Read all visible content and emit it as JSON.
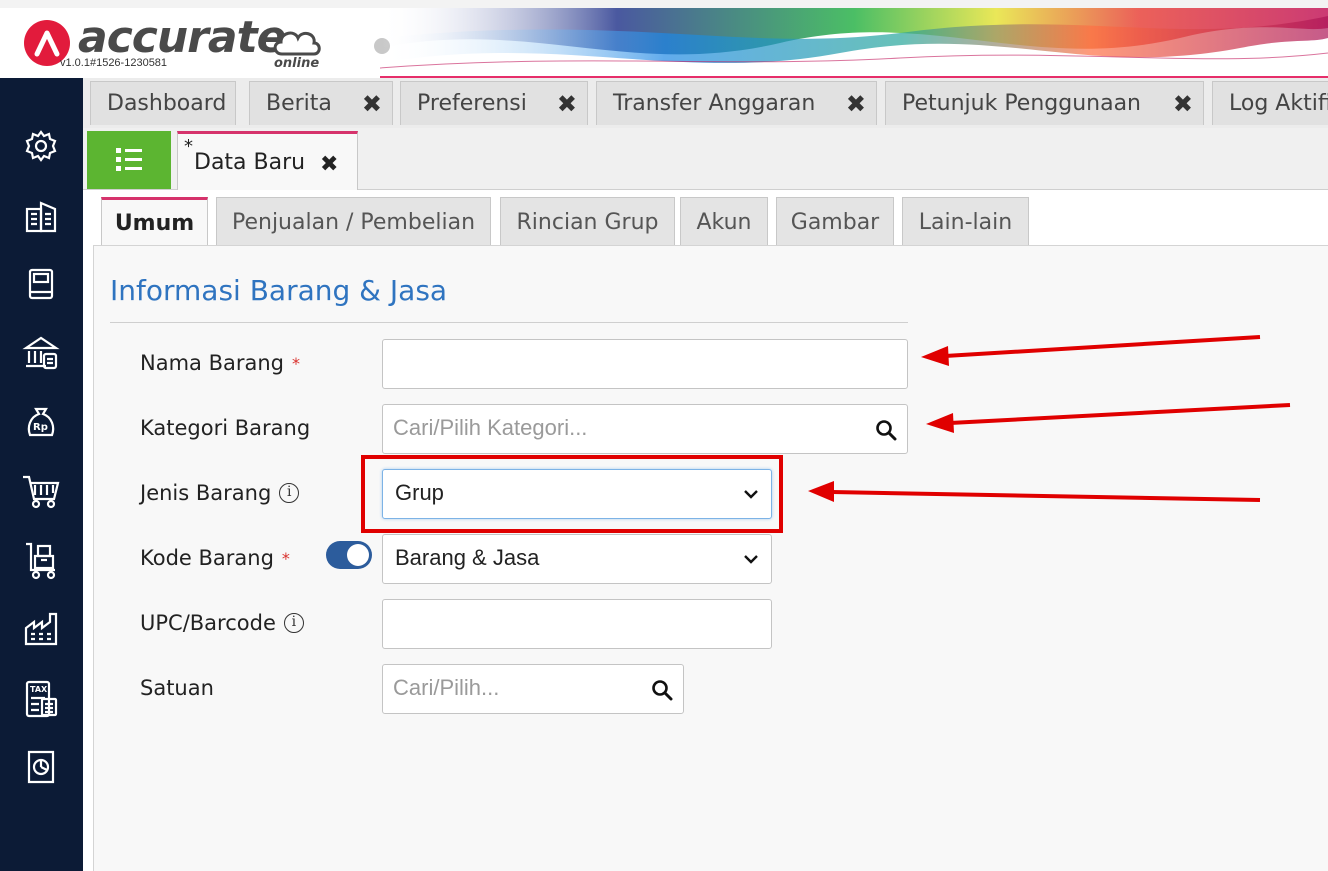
{
  "header": {
    "brand": "accurate",
    "brand_sub": "online",
    "version": "v1.0.1#1526-1230581"
  },
  "sidebar": {
    "items": [
      {
        "icon": "gear-icon"
      },
      {
        "icon": "building-icon"
      },
      {
        "icon": "book-icon"
      },
      {
        "icon": "bank-icon"
      },
      {
        "icon": "money-bag-icon"
      },
      {
        "icon": "cart-icon"
      },
      {
        "icon": "box-cart-icon"
      },
      {
        "icon": "factory-icon"
      },
      {
        "icon": "tax-icon"
      },
      {
        "icon": "report-chart-icon"
      }
    ],
    "bag_label": "Rp",
    "tax_label": "TAX"
  },
  "top_tabs": [
    {
      "label": "Dashboard",
      "closable": false
    },
    {
      "label": "Berita",
      "closable": true
    },
    {
      "label": "Preferensi",
      "closable": true
    },
    {
      "label": "Transfer Anggaran",
      "closable": true
    },
    {
      "label": "Petunjuk Penggunaan",
      "closable": true
    },
    {
      "label": "Log Aktifi",
      "closable": false
    }
  ],
  "close_glyph": "✖",
  "doc_tab": {
    "modified_mark": "*",
    "label": "Data Baru"
  },
  "inner_tabs": [
    {
      "label": "Umum",
      "active": true
    },
    {
      "label": "Penjualan / Pembelian",
      "active": false
    },
    {
      "label": "Rincian Grup",
      "active": false
    },
    {
      "label": "Akun",
      "active": false
    },
    {
      "label": "Gambar",
      "active": false
    },
    {
      "label": "Lain-lain",
      "active": false
    }
  ],
  "section": {
    "title": "Informasi Barang & Jasa"
  },
  "form": {
    "nama_barang": {
      "label": "Nama Barang",
      "required_mark": "*",
      "value": ""
    },
    "kategori_barang": {
      "label": "Kategori Barang",
      "placeholder": "Cari/Pilih Kategori..."
    },
    "jenis_barang": {
      "label": "Jenis Barang",
      "info_mark": "i",
      "selected": "Grup"
    },
    "kode_barang": {
      "label": "Kode Barang",
      "required_mark": "*",
      "toggle_on": true,
      "selected": "Barang & Jasa"
    },
    "upc_barcode": {
      "label": "UPC/Barcode",
      "info_mark": "i",
      "value": ""
    },
    "satuan": {
      "label": "Satuan",
      "placeholder": "Cari/Pilih..."
    }
  },
  "colors": {
    "sidebar_bg": "#0c1b36",
    "accent_green": "#5cb531",
    "accent_pink": "#d6336c",
    "title_blue": "#2f74c0",
    "annotation_red": "#e00000"
  }
}
